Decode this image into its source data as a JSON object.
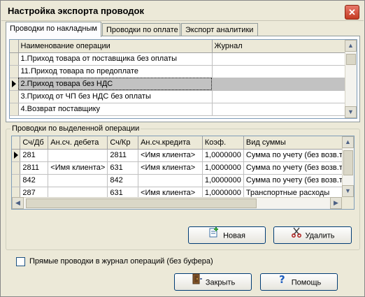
{
  "window": {
    "title": "Настройка экспорта проводок",
    "close_glyph": "✕"
  },
  "tabs": [
    {
      "label": "Проводки по накладным",
      "active": true
    },
    {
      "label": "Проводки по оплате",
      "active": false
    },
    {
      "label": "Экспорт аналитики",
      "active": false
    }
  ],
  "operations": {
    "columns": [
      "Наименование операции",
      "Журнал"
    ],
    "rows": [
      {
        "name": "1.Приход товара от поставщика без оплаты",
        "journal": ""
      },
      {
        "name": "11.Приход товара по предоплате",
        "journal": ""
      },
      {
        "name": "2.Приход товара без НДС",
        "journal": "",
        "selected": true
      },
      {
        "name": "3.Приход от ЧП без НДС без оплаты",
        "journal": ""
      },
      {
        "name": "4.Возврат поставщику",
        "journal": ""
      }
    ]
  },
  "entries": {
    "group_label": "Проводки по выделенной операции",
    "columns": [
      "Сч/Дб",
      "Ан.сч. дебета",
      "Сч/Кр",
      "Ан.сч.кредита",
      "Коэф.",
      "Вид суммы"
    ],
    "rows": [
      {
        "cells": [
          "281",
          "",
          "2811",
          "<Имя клиента>",
          "1,0000000",
          "Сумма по учету (без возв.тар"
        ],
        "current": true
      },
      {
        "cells": [
          "2811",
          "<Имя клиента>",
          "631",
          "<Имя клиента>",
          "1,0000000",
          "Сумма по учету (без возв.тар"
        ]
      },
      {
        "cells": [
          "842",
          "",
          "842",
          "",
          "1,0000000",
          "Сумма по учету (без возв.тар"
        ]
      },
      {
        "cells": [
          "287",
          "",
          "631",
          "<Имя клиента>",
          "1,0000000",
          "Транспортные расходы"
        ]
      }
    ]
  },
  "buttons": {
    "new": "Новая",
    "delete": "Удалить",
    "close": "Закрыть",
    "help": "Помощь"
  },
  "checkbox": {
    "label": "Прямые проводки в журнал операций (без буфера)",
    "checked": false
  },
  "colors": {
    "selection": "#c2c2c2",
    "grid_border": "#7f9db9",
    "face": "#ece9d8"
  }
}
